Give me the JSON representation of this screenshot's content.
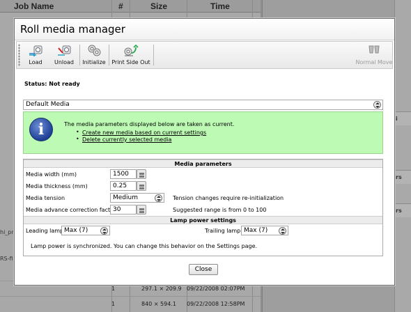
{
  "background": {
    "columns": [
      "Job Name",
      "#",
      "Size",
      "Time"
    ],
    "side_labels": [
      "hi_pr",
      "RS-fin"
    ],
    "right_labels": [
      "i",
      "rs",
      "rs"
    ],
    "rows": [
      {
        "count": "1",
        "size": "297.1 × 209.9",
        "time": "09/22/2008 02:07PM"
      },
      {
        "count": "1",
        "size": "840 × 594.1",
        "time": "09/22/2008 12:58PM"
      }
    ]
  },
  "dialog": {
    "title": "Roll media manager",
    "toolbar": [
      {
        "id": "load",
        "label": "Load",
        "icon": "load-icon"
      },
      {
        "id": "unload",
        "label": "Unload",
        "icon": "unload-icon"
      },
      {
        "id": "initialize",
        "label": "Initialize",
        "icon": "initialize-icon"
      },
      {
        "id": "print_side_out",
        "label": "Print Side Out",
        "icon": "print-side-out-icon"
      },
      {
        "id": "normal_move",
        "label": "Normal Move",
        "icon": "normal-move-icon",
        "disabled": true
      }
    ],
    "status": "Status: Not ready",
    "media_select": "Default Media",
    "info": {
      "text": "The media parameters displayed below are taken as current.",
      "links": [
        "Create new media based on current settings",
        "Delete currently selected media"
      ]
    },
    "media_parameters": {
      "title": "Media parameters",
      "width_label": "Media width (mm)",
      "width_value": "1500",
      "thickness_label": "Media thickness (mm)",
      "thickness_value": "0.25",
      "tension_label": "Media tension",
      "tension_value": "Medium",
      "tension_note": "Tension changes require re-initialization",
      "advance_label": "Media advance correction factor",
      "advance_value": "30",
      "advance_note": "Suggested range is from 0 to 100"
    },
    "lamp_power": {
      "title": "Lamp power settings",
      "leading_label": "Leading lamp",
      "leading_value": "Max (7)",
      "trailing_label": "Trailing lamp",
      "trailing_value": "Max (7)",
      "note": "Lamp power is synchronized. You can change this behavior on the Settings page."
    },
    "close_label": "Close"
  }
}
